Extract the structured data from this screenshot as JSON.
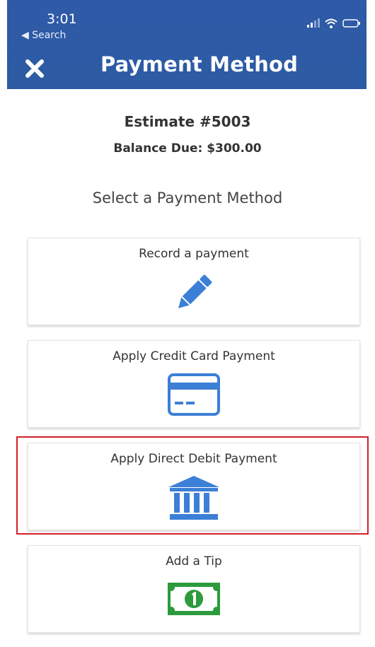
{
  "status_bar": {
    "time": "3:01",
    "back_label": "◀ Search"
  },
  "header": {
    "title": "Payment Method"
  },
  "estimate": {
    "title": "Estimate #5003",
    "balance": "Balance Due: $300.00"
  },
  "prompt": "Select a Payment Method",
  "options": [
    {
      "label": "Record a payment",
      "icon": "pencil-icon"
    },
    {
      "label": "Apply Credit Card Payment",
      "icon": "credit-card-icon"
    },
    {
      "label": "Apply Direct Debit Payment",
      "icon": "bank-icon",
      "highlighted": true
    },
    {
      "label": "Add a Tip",
      "icon": "dollar-bill-icon"
    }
  ],
  "colors": {
    "header": "#2d5ba3",
    "icon_blue": "#3c7fd6",
    "bill_green": "#2c9b3c",
    "highlight": "#d3202a"
  }
}
